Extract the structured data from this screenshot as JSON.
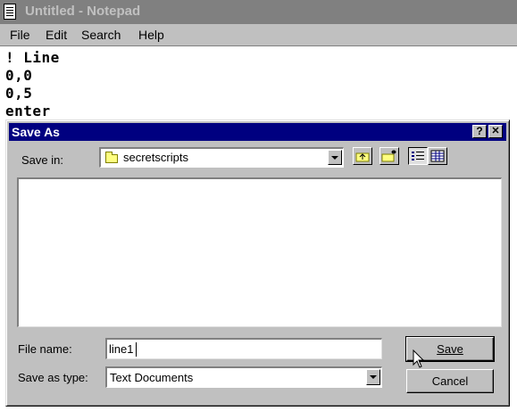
{
  "notepad": {
    "title": "Untitled - Notepad",
    "menu": [
      "File",
      "Edit",
      "Search",
      "Help"
    ],
    "lines": [
      "! Line",
      "0,0",
      "0,5",
      "enter"
    ]
  },
  "dialog": {
    "title": "Save As",
    "help_glyph": "?",
    "close_glyph": "✕",
    "save_in_label": "Save in:",
    "save_in_value": "secretscripts",
    "file_name_label": "File name:",
    "file_name_value": "line1",
    "save_as_type_label": "Save as type:",
    "save_as_type_value": "Text Documents",
    "save_button": "Save",
    "cancel_button": "Cancel"
  },
  "colors": {
    "title_active": "#000080",
    "title_inactive": "#808080",
    "face": "#c0c0c0"
  },
  "icons": [
    "notepad-icon",
    "folder-icon",
    "up-one-level-icon",
    "create-new-folder-icon",
    "list-view-icon",
    "details-view-icon",
    "help-icon",
    "close-icon",
    "arrow-pointer-icon"
  ]
}
